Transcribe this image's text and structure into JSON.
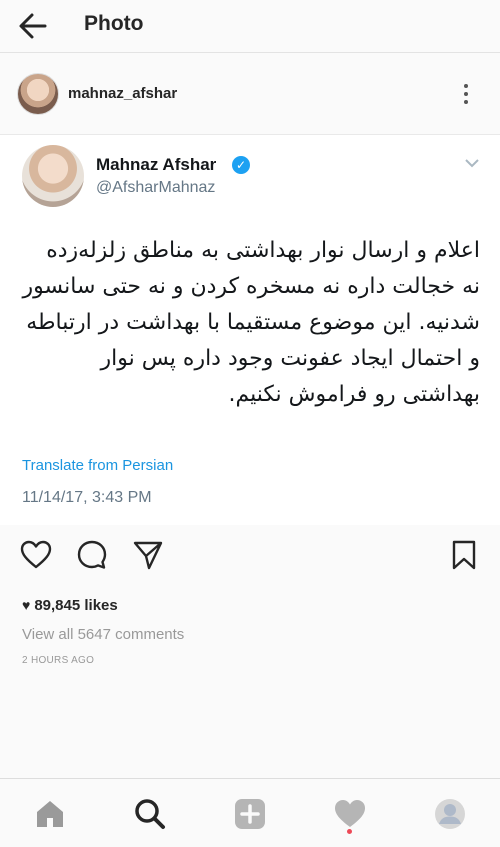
{
  "header": {
    "title": "Photo"
  },
  "post": {
    "username": "mahnaz_afshar",
    "likes": "89,845 likes",
    "comments_link": "View all 5647 comments",
    "time_ago": "2 HOURS AGO"
  },
  "tweet": {
    "display_name": "Mahnaz Afshar",
    "handle": "@AfsharMahnaz",
    "text": "اعلام و ارسال نوار بهداشتی به مناطق زلزله‌زده نه خجالت داره نه مسخره کردن و نه حتی سانسور شدنیه. این موضوع مستقیما با بهداشت در ارتباطه و احتمال ایجاد عفونت وجود داره پس نوار بهداشتی رو فراموش نکنیم.",
    "translate_label": "Translate from Persian",
    "date": "11/14/17, 3:43 PM",
    "verified_color": "#1da1f2"
  },
  "icons": {
    "back": "arrow-left-icon",
    "more": "vertical-dots-icon",
    "like": "heart-outline-icon",
    "comment": "speech-bubble-icon",
    "share": "paper-plane-icon",
    "save": "bookmark-icon",
    "nav_home": "home-icon",
    "nav_search": "search-icon",
    "nav_add": "plus-square-icon",
    "nav_activity": "heart-icon",
    "nav_profile": "profile-avatar-icon"
  },
  "colors": {
    "link": "#1b95e0",
    "notification_dot": "#ed4956"
  }
}
